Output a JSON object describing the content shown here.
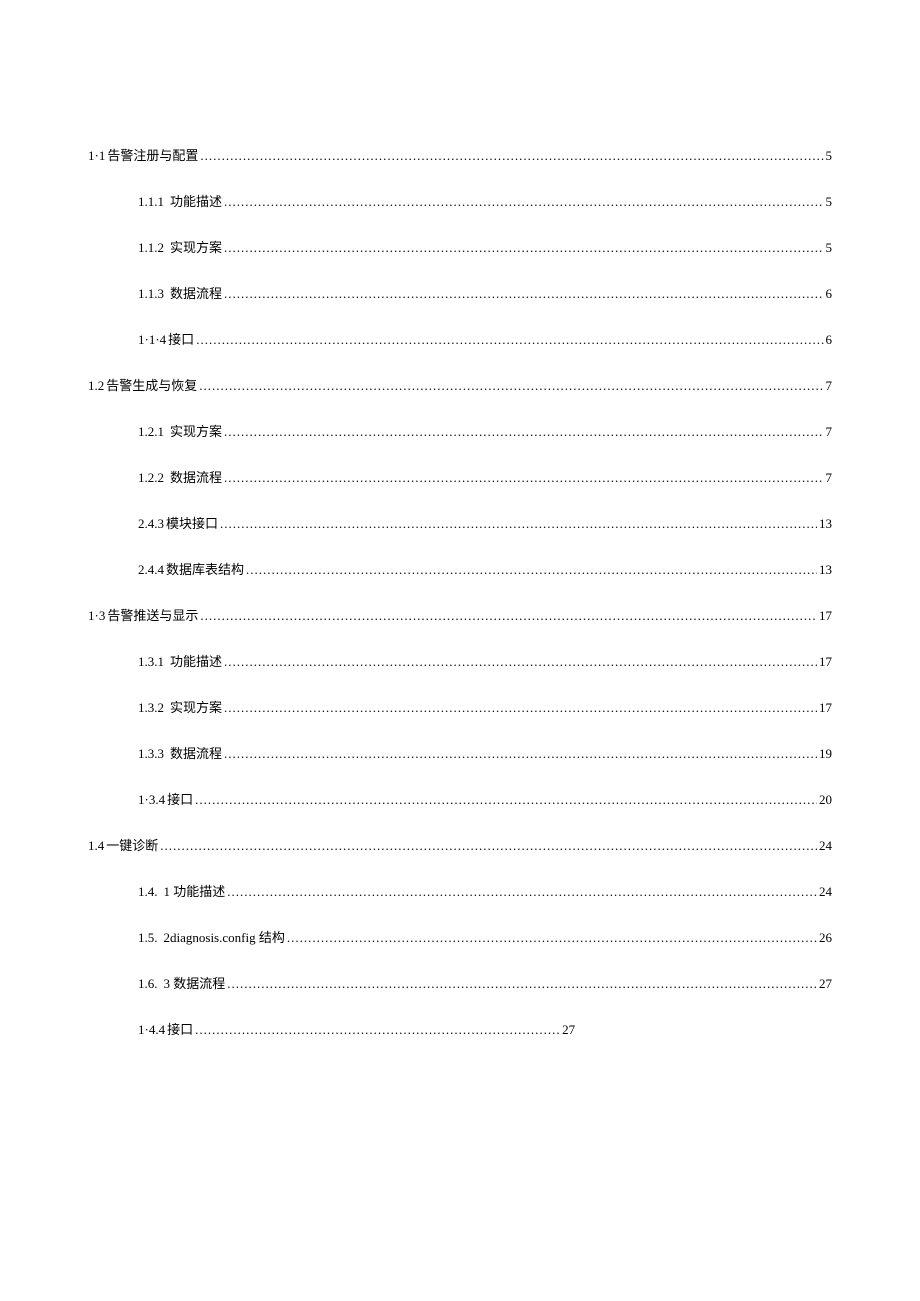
{
  "toc": [
    {
      "level": 1,
      "number": "1·1",
      "title": "告警注册与配置",
      "page": "5",
      "tight": true
    },
    {
      "level": 2,
      "number": "1.1.1",
      "title": "功能描述",
      "page": "5"
    },
    {
      "level": 2,
      "number": "1.1.2",
      "title": "实现方案",
      "page": "5"
    },
    {
      "level": 2,
      "number": "1.1.3",
      "title": "数据流程",
      "page": "6"
    },
    {
      "level": 2,
      "number": "1·1·4",
      "title": "接口",
      "page": "6",
      "tight": true
    },
    {
      "level": 1,
      "number": "1.2",
      "title": "告警生成与恢复",
      "page": "7",
      "tight": true
    },
    {
      "level": 2,
      "number": "1.2.1",
      "title": "实现方案",
      "page": "7"
    },
    {
      "level": 2,
      "number": "1.2.2",
      "title": "数据流程",
      "page": "7"
    },
    {
      "level": 2,
      "number": "2.4.3",
      "title": "模块接口",
      "page": "13",
      "tight": true
    },
    {
      "level": 2,
      "number": "2.4.4",
      "title": "数据库表结构",
      "page": "13",
      "tight": true
    },
    {
      "level": 1,
      "number": "1·3",
      "title": "告警推送与显示",
      "page": "17",
      "tight": true
    },
    {
      "level": 2,
      "number": "1.3.1",
      "title": "功能描述",
      "page": "17"
    },
    {
      "level": 2,
      "number": "1.3.2",
      "title": "实现方案",
      "page": "17"
    },
    {
      "level": 2,
      "number": "1.3.3",
      "title": "数据流程",
      "page": "19"
    },
    {
      "level": 2,
      "number": "1·3.4",
      "title": "接口",
      "page": "20",
      "tight": true
    },
    {
      "level": 1,
      "number": "1.4",
      "title": "一键诊断",
      "page": "24",
      "tight": true
    },
    {
      "level": 2,
      "number": "1.4.",
      "title": "1 功能描述",
      "page": "24"
    },
    {
      "level": 2,
      "number": "1.5.",
      "title": "2diagnosis.config 结构",
      "page": "26"
    },
    {
      "level": 2,
      "number": "1.6.",
      "title": "3 数据流程",
      "page": "27"
    },
    {
      "level": 2,
      "number": "1·4.4",
      "title": "接口",
      "page": "27",
      "tight": true,
      "shortDots": true
    }
  ]
}
